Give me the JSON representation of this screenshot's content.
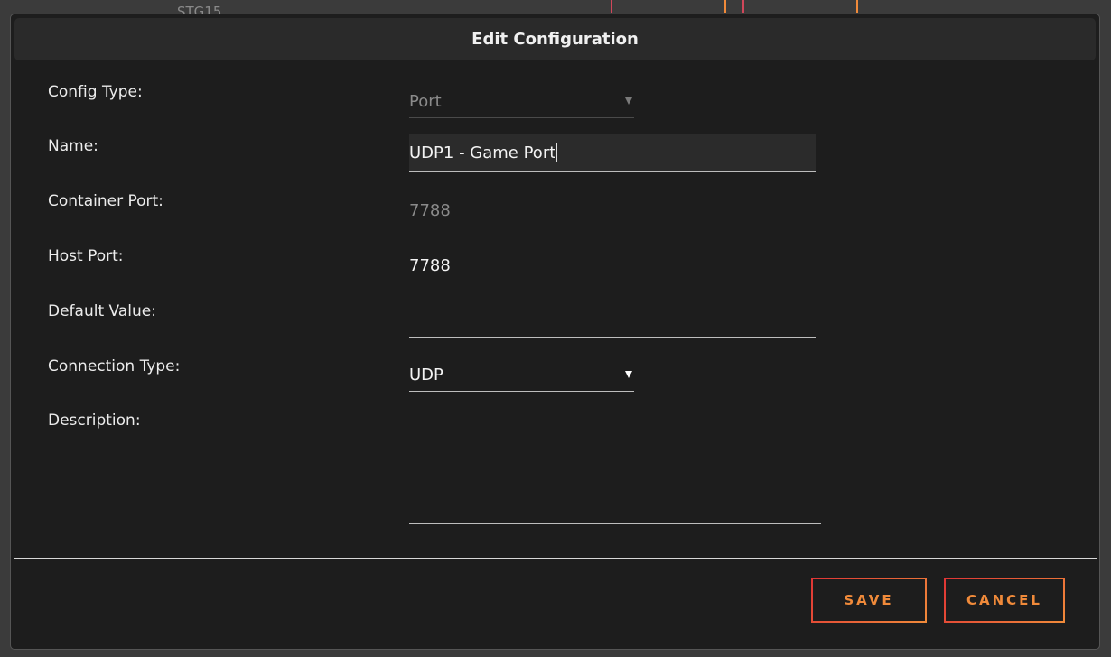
{
  "background": {
    "fragment_text": "STG15"
  },
  "dialog": {
    "title": "Edit Configuration"
  },
  "form": {
    "config_type": {
      "label": "Config Type:",
      "value": "Port"
    },
    "name": {
      "label": "Name:",
      "value": "UDP1 - Game Port"
    },
    "container_port": {
      "label": "Container Port:",
      "value": "7788"
    },
    "host_port": {
      "label": "Host Port:",
      "value": "7788"
    },
    "default_value": {
      "label": "Default Value:",
      "value": ""
    },
    "connection_type": {
      "label": "Connection Type:",
      "value": "UDP"
    },
    "description": {
      "label": "Description:",
      "value": ""
    }
  },
  "actions": {
    "save_label": "SAVE",
    "cancel_label": "CANCEL"
  },
  "colors": {
    "accent_orange": "#f08a3a",
    "accent_red": "#e03535",
    "dialog_bg": "#1d1d1d",
    "header_bg": "#2a2a2a"
  },
  "icons": {
    "dropdown": "triangle-down-icon"
  }
}
